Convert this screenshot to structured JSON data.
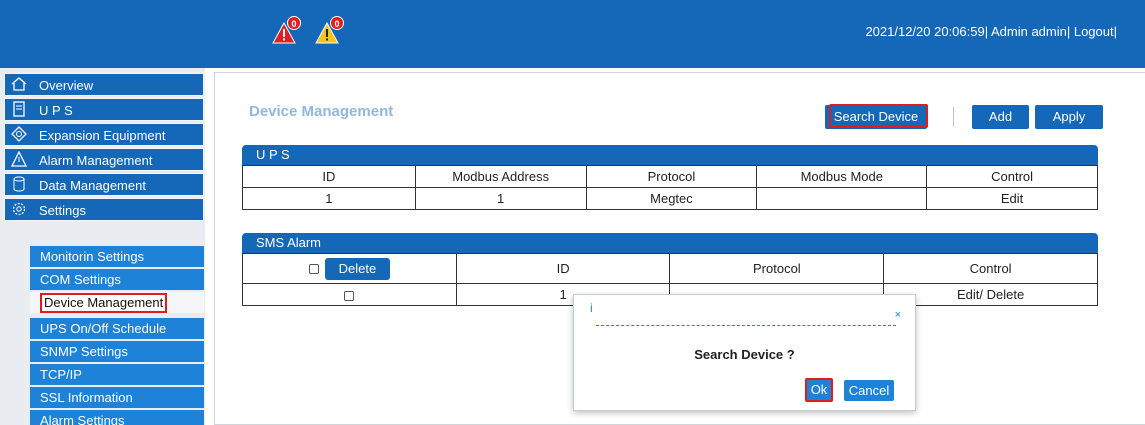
{
  "header": {
    "alarms": [
      {
        "color": "red",
        "count": "0",
        "icon": "warning-triangle-red-icon"
      },
      {
        "color": "yellow",
        "count": "0",
        "icon": "warning-triangle-yellow-icon"
      }
    ],
    "datetime": "2021/12/20 20:06:59|",
    "user": " Admin admin|",
    "logout": " Logout|"
  },
  "sidebar": {
    "menu": [
      {
        "label": "Overview",
        "icon": "home-icon"
      },
      {
        "label": "U P S",
        "icon": "server-icon"
      },
      {
        "label": "Expansion Equipment",
        "icon": "expansion-icon"
      },
      {
        "label": "Alarm Management",
        "icon": "warning-icon"
      },
      {
        "label": "Data Management",
        "icon": "database-icon"
      },
      {
        "label": "Settings",
        "icon": "gear-icon"
      }
    ],
    "settings_sub": [
      "Monitorin Settings",
      "COM Settings",
      "Device Management",
      "UPS On/Off Schedule",
      "SNMP Settings",
      "TCP/IP",
      "SSL Information",
      "Alarm Settings"
    ]
  },
  "main": {
    "title": "Device Management",
    "buttons": {
      "search": "Search Device",
      "add": "Add",
      "apply": "Apply"
    },
    "ups": {
      "section": "U P S",
      "columns": [
        "ID",
        "Modbus Address",
        "Protocol",
        "Modbus Mode",
        "Control"
      ],
      "rows": [
        [
          "1",
          "1",
          "Megtec",
          "",
          "Edit"
        ]
      ]
    },
    "sms": {
      "section": "SMS Alarm",
      "delete_label": "Delete",
      "columns": [
        "ID",
        "Protocol",
        "Control"
      ],
      "rows": [
        [
          "1",
          "",
          "Edit/  Delete"
        ]
      ]
    }
  },
  "dialog": {
    "info": "i",
    "close": "×",
    "message": "Search Device ?",
    "ok": "Ok",
    "cancel": "Cancel"
  },
  "colors": {
    "primary": "#1568b8",
    "highlight": "#e21b1b",
    "sub_item": "#1e82d8"
  }
}
